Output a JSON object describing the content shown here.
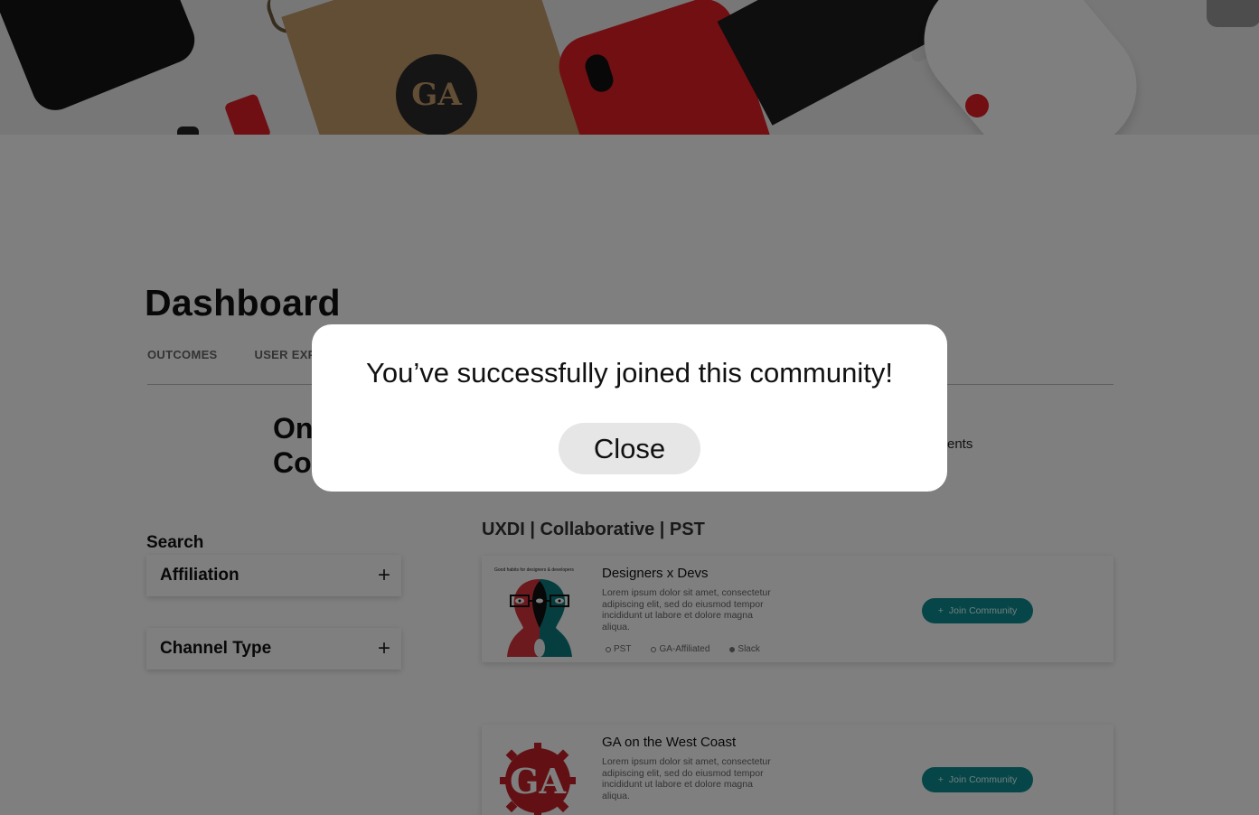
{
  "page": {
    "title": "Dashboard",
    "tabs": [
      {
        "label": "OUTCOMES"
      },
      {
        "label": "USER EXP"
      }
    ],
    "section_heading_line1": "On",
    "section_heading_line2": "Co",
    "side_note": "ents"
  },
  "filters": {
    "search_label": "Search",
    "items": [
      {
        "label": "Affiliation",
        "icon": "plus-icon"
      },
      {
        "label": "Channel Type",
        "icon": "plus-icon"
      }
    ]
  },
  "results": {
    "title": "UXDI | Collaborative | PST",
    "cards": [
      {
        "thumb_caption": "Good habits for designers & developers",
        "title": "Designers x Devs",
        "description": "Lorem ipsum dolor sit amet, consectetur adipiscing elit, sed do eiusmod tempor incididunt ut labore et dolore magna aliqua.",
        "meta": [
          "PST",
          "GA-Affiliated",
          "Slack"
        ],
        "join_label": "Join Community",
        "join_icon": "plus-icon"
      },
      {
        "title": "GA on the West Coast",
        "logo_text": "GA",
        "description": "Lorem ipsum dolor sit amet, consectetur adipiscing elit, sed do eiusmod tempor incididunt ut labore et dolore magna aliqua.",
        "join_label": "Join Community",
        "join_icon": "plus-icon"
      }
    ]
  },
  "hero": {
    "ga_logo_text": "GA"
  },
  "modal": {
    "message": "You’ve successfully joined this community!",
    "close_label": "Close"
  },
  "colors": {
    "accent": "#0e8c90",
    "brand_red": "#e31e24",
    "overlay": "rgba(0,0,0,0.5)"
  }
}
